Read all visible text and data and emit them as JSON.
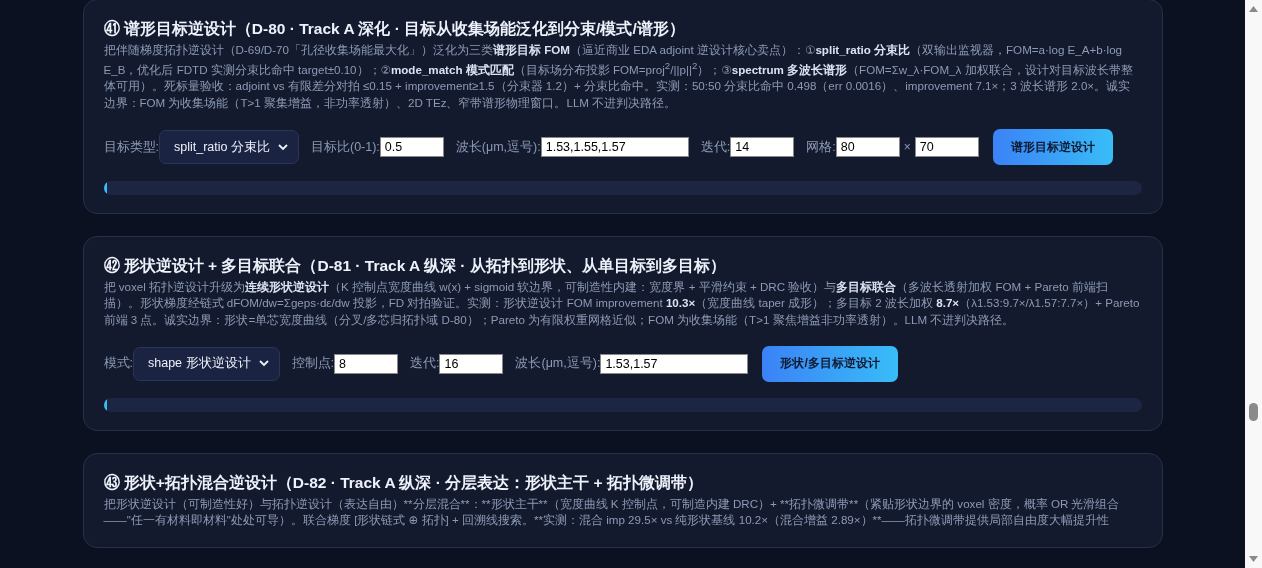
{
  "cards": [
    {
      "title": "㊶ 谱形目标逆设计（D-80 · Track A 深化 · 目标从收集场能泛化到分束/模式/谱形）",
      "description": "把伴随梯度拓扑逆设计（D-69/D-70「孔径收集场能最大化」）泛化为三类**谱形目标 FOM**（逼近商业 EDA adjoint 逆设计核心卖点）：①**split_ratio 分束比**（双输出监视器，FOM=a·log E_A+b·log E_B，优化后 FDTD 实测分束比命中 target±0.10）；②**mode_match 模式匹配**（目标场分布投影 FOM=proj$^{2}$/||p||$^{2}$）；③**spectrum 多波长谱形**（FOM=Σw_λ·FOM_λ 加权联合，设计对目标波长带整体可用）。死标量验收：adjoint vs 有限差分对拍 ≤0.15 + improvement≥1.5（分束器 1.2）+ 分束比命中。实测：50:50 分束比命中 0.498（err 0.0016）、improvement 7.1×；3 波长谱形 2.0×。诚实边界：FOM 为收集场能（T>1 聚集增益，非功率透射）、2D TEz、窄带谱形物理窗口。LLM 不进判决路径。",
      "controls": [
        {
          "kind": "select",
          "label": "目标类型:",
          "value": "split_ratio 分束比"
        },
        {
          "kind": "input",
          "label": "目标比(0-1):",
          "value": "0.5"
        },
        {
          "kind": "wide_input",
          "label": "波长(μm,逗号):",
          "value": "1.53,1.55,1.57"
        },
        {
          "kind": "input",
          "label": "迭代:",
          "value": "14"
        },
        {
          "kind": "input",
          "label": "网格:",
          "value": "80"
        },
        {
          "kind": "input",
          "label": "×",
          "value": "70"
        },
        {
          "kind": "button",
          "label": "谱形目标逆设计"
        }
      ],
      "progress": {
        "level": 0
      }
    },
    {
      "title": "㊷ 形状逆设计 + 多目标联合（D-81 · Track A 纵深 · 从拓扑到形状、从单目标到多目标）",
      "description": "把 voxel 拓扑逆设计升级为**连续形状逆设计**（K 控制点宽度曲线 w(x) + sigmoid 软边界，可制造性内建：宽度界 + 平滑约束 + DRC 验收）与**多目标联合**（多波长透射加权 FOM + Pareto 前端扫描）。形状梯度经链式 dFOM/dw=Σgeps·dε/dw 投影，FD 对拍验证。实测：形状逆设计 FOM improvement **10.3×**（宽度曲线 taper 成形）；多目标 2 波长加权 **8.7×**（λ1.53:9.7×/λ1.57:7.7×）+ Pareto 前端 3 点。诚实边界：形状=单芯宽度曲线（分叉/多芯归拓扑域 D-80）；Pareto 为有限权重网格近似；FOM 为收集场能（T>1 聚焦增益非功率透射）。LLM 不进判决路径。",
      "controls": [
        {
          "kind": "select",
          "label": "模式:",
          "value": "shape 形状逆设计"
        },
        {
          "kind": "input",
          "label": "控制点:",
          "value": "8"
        },
        {
          "kind": "input",
          "label": "迭代:",
          "value": "16"
        },
        {
          "kind": "wide_input",
          "label": "波长(μm,逗号):",
          "value": "1.53,1.57"
        },
        {
          "kind": "button",
          "label": "形状/多目标逆设计"
        }
      ],
      "progress": {
        "level": 0
      }
    },
    {
      "title": "㊸ 形状+拓扑混合逆设计（D-82 · Track A 纵深 · 分层表达：形状主干 + 拓扑微调带）",
      "description_text": "把形状逆设计（可制造性好）与拓扑逆设计（表达自由）**分层混合**：**形状主干**（宽度曲线 K 控制点，可制造内建 DRC）+ **拓扑微调带**（紧贴形状边界的 voxel 密度，概率 OR 光滑组合——\"任一有材料即材料\"处处可导）。联合梯度 [形状链式 ⊕ 拓扑] + 回溯线搜索。**实测：混合 imp 29.5× vs 纯形状基线 10.2×（混合增益 2.89×）**——拓扑微调带提供局部自由度大幅提升性"
    }
  ]
}
